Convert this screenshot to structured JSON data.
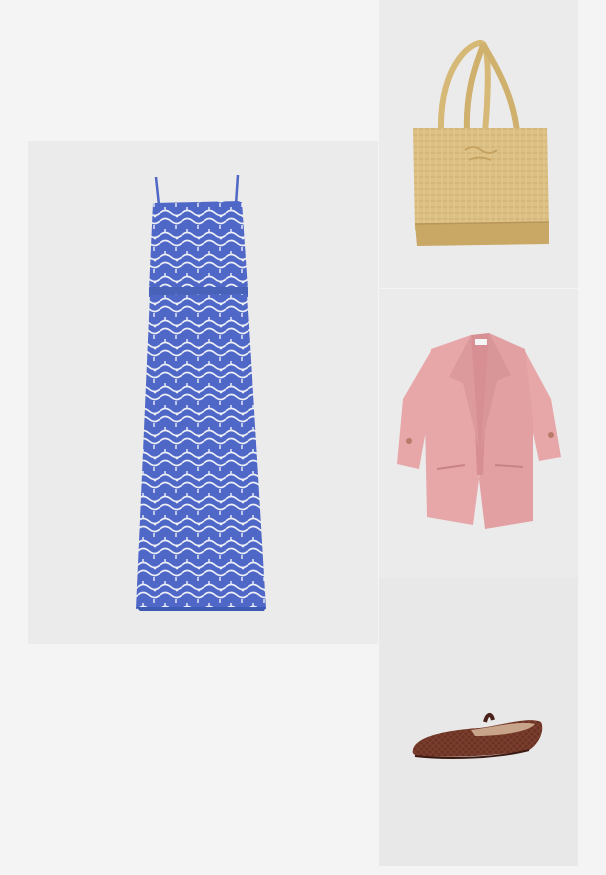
{
  "collage": {
    "background": "#f4f4f4",
    "panel_background": "#ebebeb",
    "items": [
      {
        "name": "maxi-dress",
        "colors": {
          "primary": "#4f67c6",
          "pattern": "#eef0f8"
        }
      },
      {
        "name": "straw-tote-bag",
        "colors": {
          "primary": "#dcc084",
          "shade": "#c9a865"
        }
      },
      {
        "name": "blazer",
        "colors": {
          "primary": "#e7a7a9",
          "shade": "#d38e91"
        }
      },
      {
        "name": "ballet-flat",
        "colors": {
          "primary": "#6b3326",
          "shade": "#4a2118"
        }
      }
    ]
  }
}
